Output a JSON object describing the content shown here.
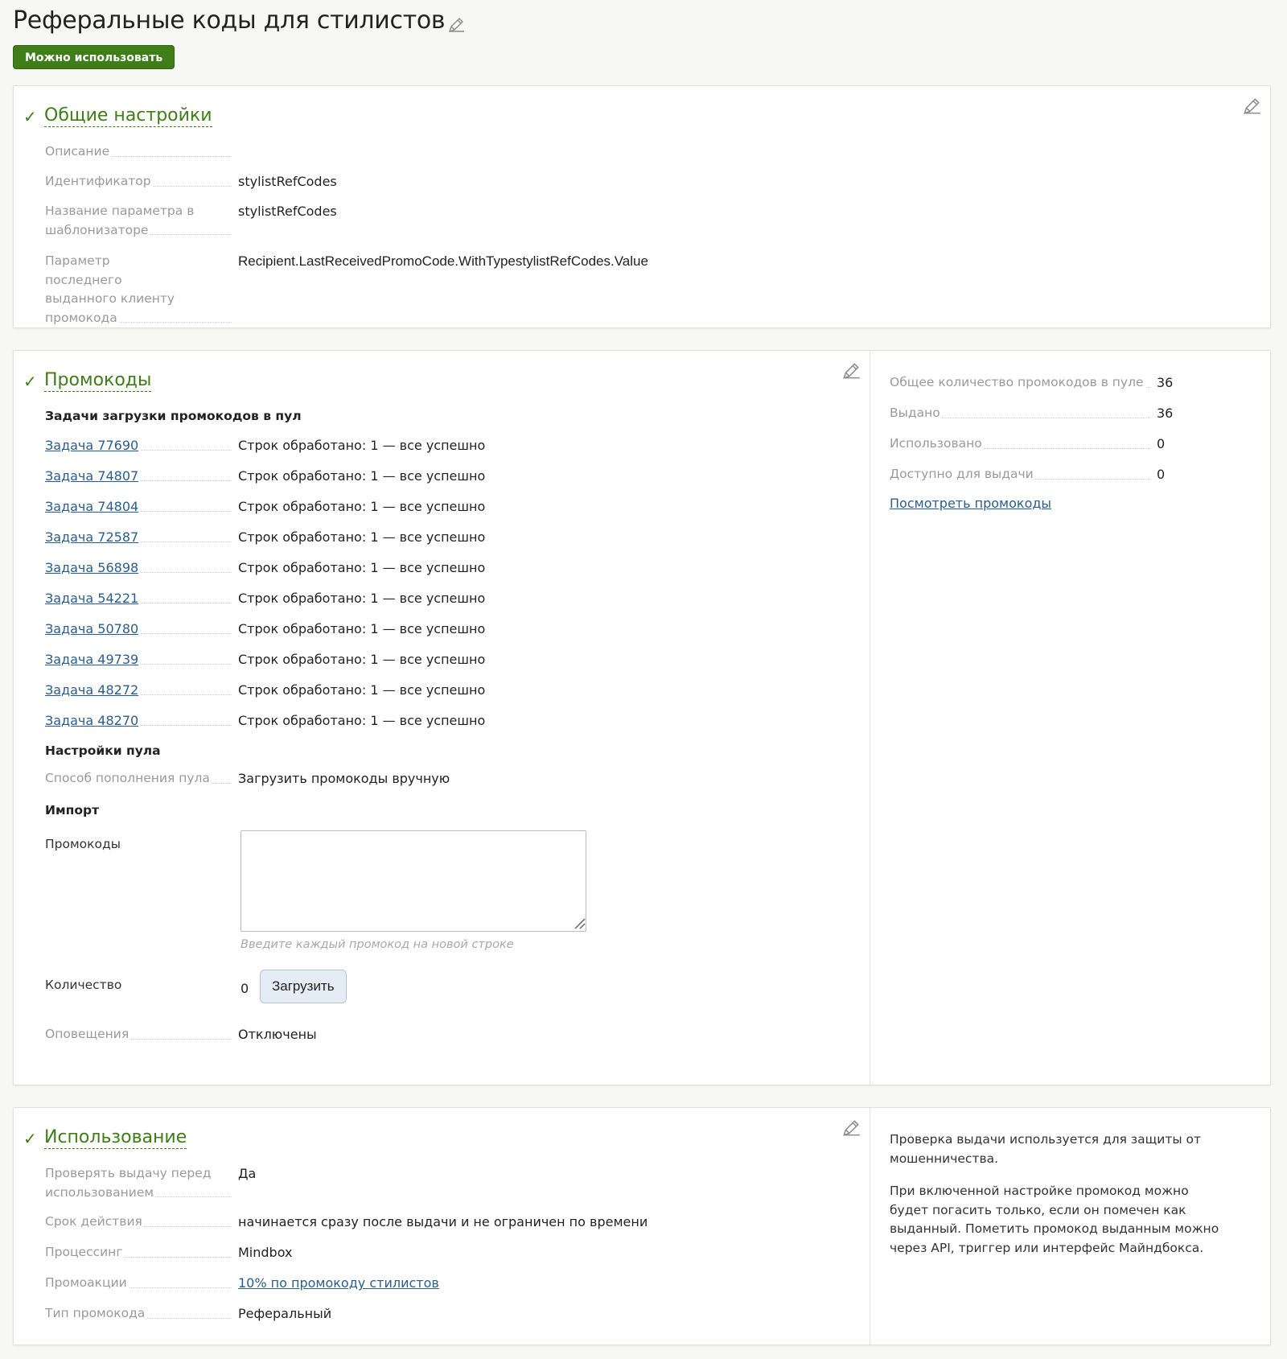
{
  "page": {
    "title": "Реферальные коды для стилистов",
    "status_badge": "Можно использовать",
    "colors": {
      "accent": "#3e7d17",
      "link": "#2a5d8f"
    }
  },
  "general": {
    "title": "Общие настройки",
    "rows": [
      {
        "label": "Описание",
        "value": ""
      },
      {
        "label": "Идентификатор",
        "value": "stylistRefCodes"
      },
      {
        "label": "Название параметра в шаблонизаторе",
        "value": "stylistRefCodes"
      },
      {
        "label": "Параметр последнего выданного клиенту промокода",
        "value": "Recipient.LastReceivedPromoCode.WithTypestylistRefCodes.Value"
      }
    ]
  },
  "promocodes": {
    "title": "Промокоды",
    "tasks_heading": "Задачи загрузки промокодов в пул",
    "tasks": [
      {
        "link": "Задача 77690",
        "status": "Строк обработано: 1 — все успешно"
      },
      {
        "link": "Задача 74807",
        "status": "Строк обработано: 1 — все успешно"
      },
      {
        "link": "Задача 74804",
        "status": "Строк обработано: 1 — все успешно"
      },
      {
        "link": "Задача 72587",
        "status": "Строк обработано: 1 — все успешно"
      },
      {
        "link": "Задача 56898",
        "status": "Строк обработано: 1 — все успешно"
      },
      {
        "link": "Задача 54221",
        "status": "Строк обработано: 1 — все успешно"
      },
      {
        "link": "Задача 50780",
        "status": "Строк обработано: 1 — все успешно"
      },
      {
        "link": "Задача 49739",
        "status": "Строк обработано: 1 — все успешно"
      },
      {
        "link": "Задача 48272",
        "status": "Строк обработано: 1 — все успешно"
      },
      {
        "link": "Задача 48270",
        "status": "Строк обработано: 1 — все успешно"
      }
    ],
    "pool_heading": "Настройки пула",
    "pool_method_label": "Способ пополнения пула",
    "pool_method_value": "Загрузить промокоды вручную",
    "import_heading": "Импорт",
    "codes_label": "Промокоды",
    "codes_value": "",
    "codes_hint": "Введите каждый промокод на новой строке",
    "count_label": "Количество",
    "count_value": "0",
    "upload_button": "Загрузить",
    "notify_label": "Оповещения",
    "notify_value": "Отключены",
    "stats": [
      {
        "label": "Общее количество промокодов в пуле",
        "value": "36"
      },
      {
        "label": "Выдано",
        "value": "36"
      },
      {
        "label": "Использовано",
        "value": "0"
      },
      {
        "label": "Доступно для выдачи",
        "value": "0"
      }
    ],
    "view_link": "Посмотреть промокоды"
  },
  "usage": {
    "title": "Использование",
    "rows": [
      {
        "label": "Проверять выдачу перед использованием",
        "value": "Да"
      },
      {
        "label": "Срок действия",
        "value": "начинается сразу после выдачи и не ограничен по времени"
      },
      {
        "label": "Процессинг",
        "value": "Mindbox"
      },
      {
        "label": "Промоакции",
        "value": "10% по промокоду стилистов"
      },
      {
        "label": "Тип промокода",
        "value": "Реферальный"
      }
    ],
    "info_p1": "Проверка выдачи используется для защиты от мошенничества.",
    "info_p2": "При включенной настройке промокод можно будет погасить только, если он помечен как выданный. Пометить промокод выданным можно через API, триггер или интерфейс Майндбокса."
  }
}
